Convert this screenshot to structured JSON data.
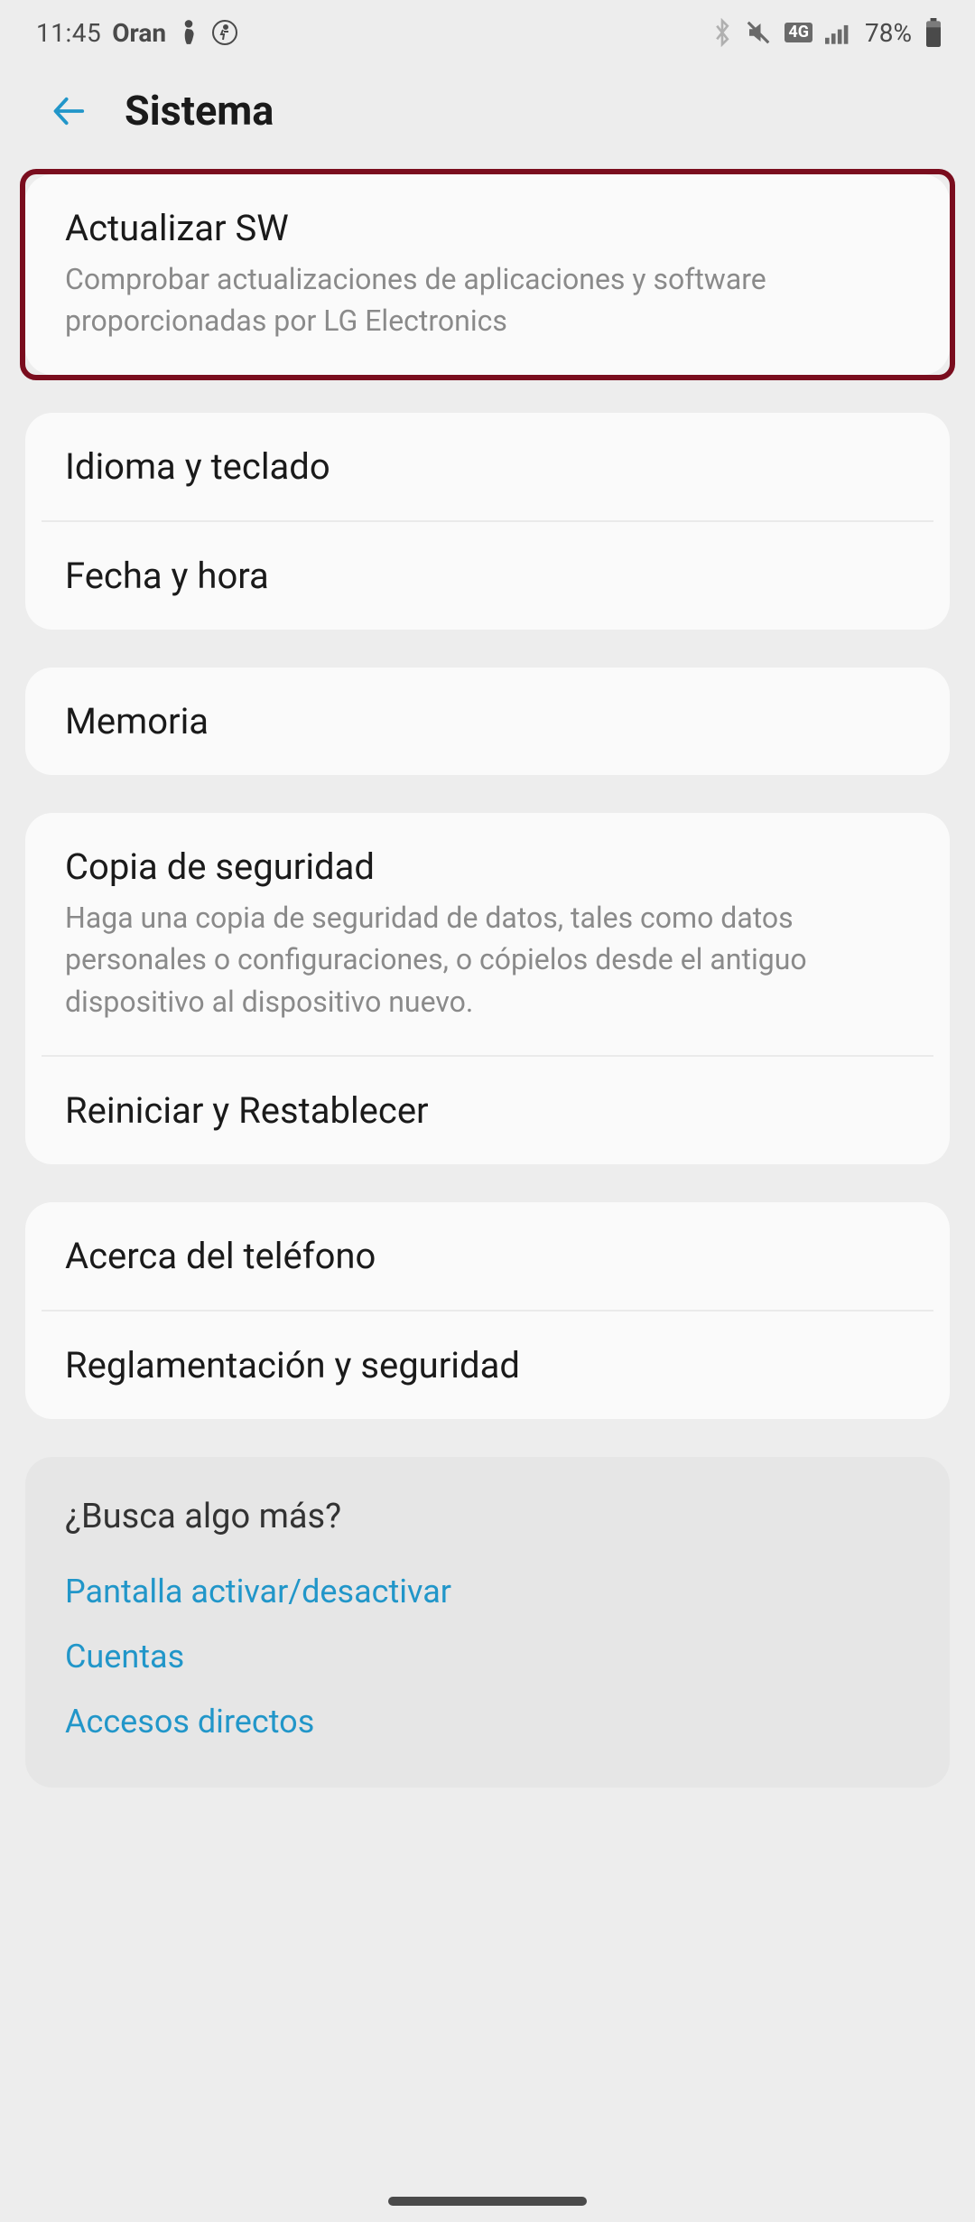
{
  "status": {
    "time": "11:45",
    "carrier": "Oran",
    "battery_text": "78%",
    "network_label": "4G"
  },
  "header": {
    "title": "Sistema"
  },
  "groups": [
    {
      "highlighted": true,
      "items": [
        {
          "title": "Actualizar SW",
          "desc": "Comprobar actualizaciones de aplicaciones y software proporcionadas por LG Electronics"
        }
      ]
    },
    {
      "items": [
        {
          "title": "Idioma y teclado"
        },
        {
          "title": "Fecha y hora"
        }
      ]
    },
    {
      "items": [
        {
          "title": "Memoria"
        }
      ]
    },
    {
      "items": [
        {
          "title": "Copia de seguridad",
          "desc": "Haga una copia de seguridad de datos, tales como datos personales o configuraciones, o cópielos desde el antiguo dispositivo al dispositivo nuevo."
        },
        {
          "title": "Reiniciar y Restablecer"
        }
      ]
    },
    {
      "items": [
        {
          "title": "Acerca del teléfono"
        },
        {
          "title": "Reglamentación y seguridad"
        }
      ]
    }
  ],
  "footer": {
    "title": "¿Busca algo más?",
    "links": [
      "Pantalla activar/desactivar",
      "Cuentas",
      "Accesos directos"
    ]
  }
}
